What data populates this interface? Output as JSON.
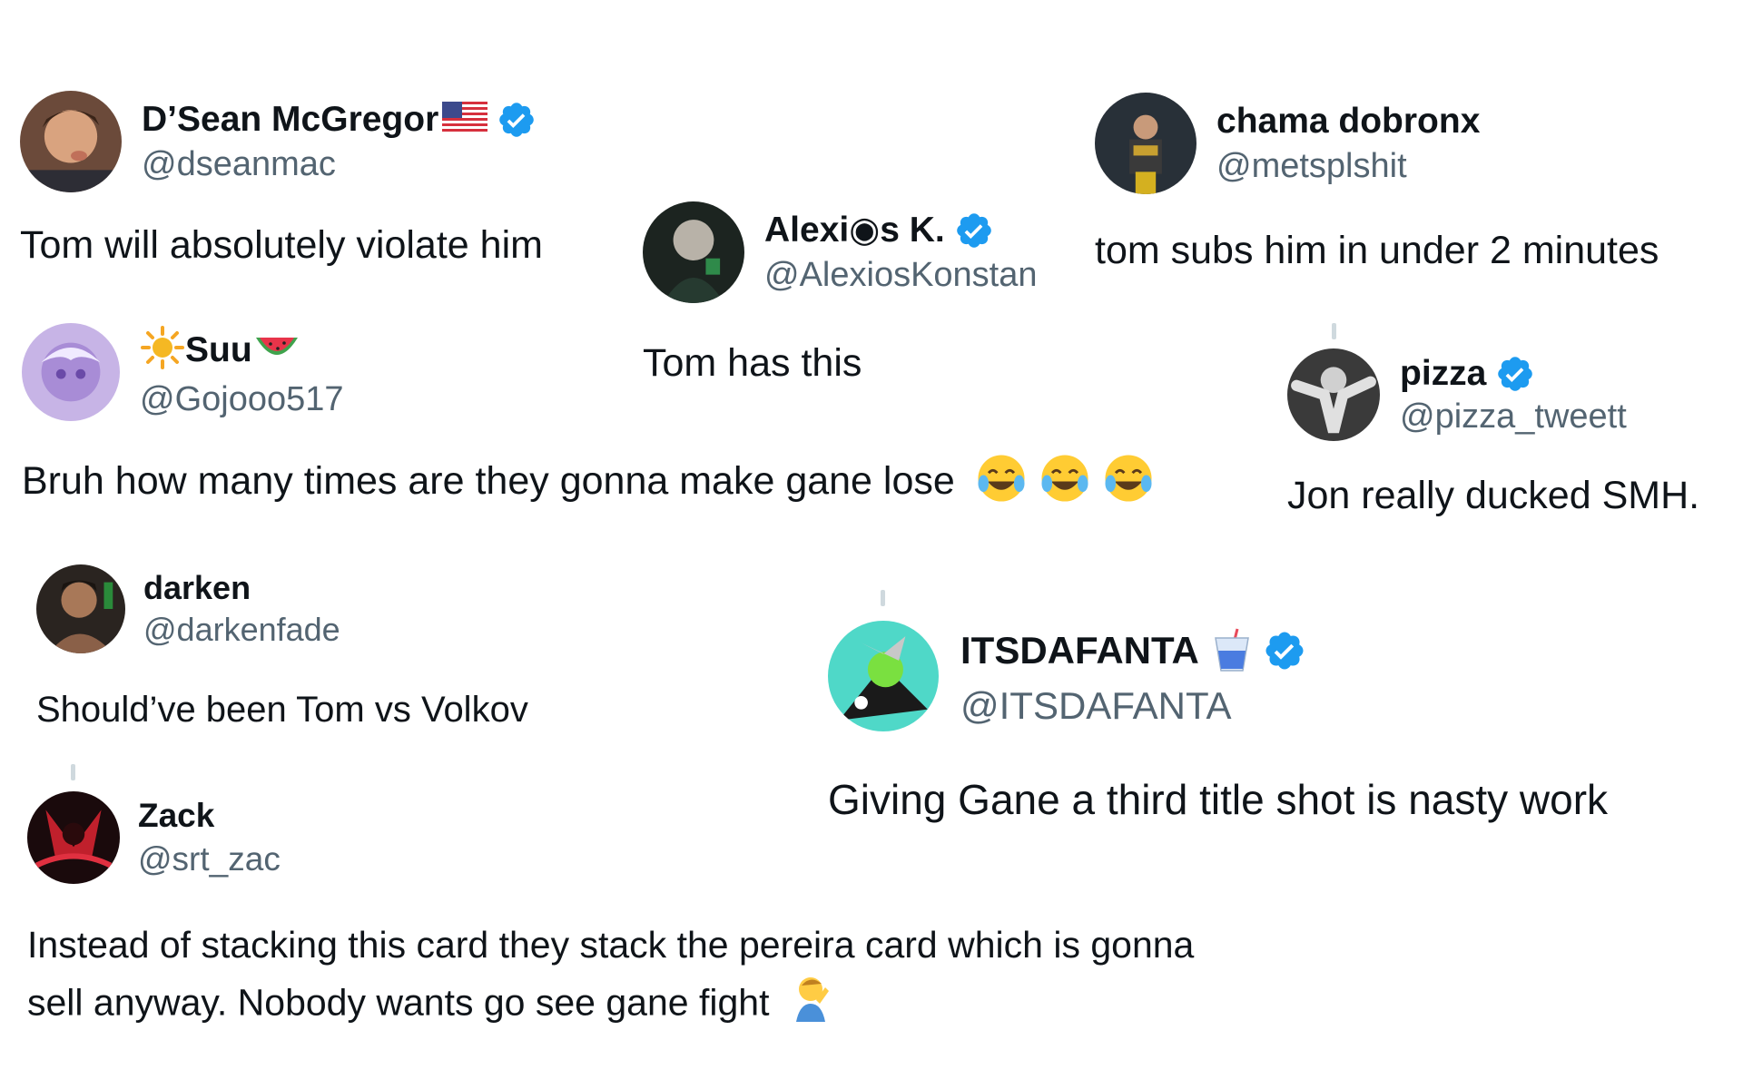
{
  "colors": {
    "text": "#0f1419",
    "handle": "#536471",
    "verified": "#1d9bf0",
    "thread_line": "#cfd9de"
  },
  "tweets": [
    {
      "id": "dseanmac",
      "name": "D’Sean McGregor",
      "name_emoji": "flag-usa-icon",
      "verified": true,
      "handle": "@dseanmac",
      "text": "Tom will absolutely violate him"
    },
    {
      "id": "alexios",
      "name": "Alexi◉s K.",
      "verified": true,
      "handle": "@AlexiosKonstan",
      "text": "Tom has this"
    },
    {
      "id": "metsplshit",
      "name": "chama dobronx",
      "verified": false,
      "handle": "@metsplshit",
      "text": "tom subs him in under 2 minutes"
    },
    {
      "id": "gojooo",
      "name": "Suu",
      "name_prefix_emoji": "sun-icon",
      "name_suffix_emoji": "watermelon-icon",
      "verified": false,
      "handle": "@Gojooo517",
      "text": "Bruh how many times are they gonna make gane lose",
      "trailing_emoji": [
        "laughing-crying-icon",
        "laughing-crying-icon",
        "laughing-crying-icon"
      ]
    },
    {
      "id": "pizza",
      "name": "pizza",
      "verified": true,
      "handle": "@pizza_tweett",
      "text": "Jon really ducked SMH."
    },
    {
      "id": "darken",
      "name": "darken",
      "verified": false,
      "handle": "@darkenfade",
      "text": "Should’ve been Tom vs Volkov"
    },
    {
      "id": "itsdafanta",
      "name": "ITSDAFANTA",
      "name_emoji": "drink-cup-icon",
      "verified": true,
      "handle": "@ITSDAFANTA",
      "text": "Giving Gane a third title shot is nasty work"
    },
    {
      "id": "zack",
      "name": "Zack",
      "verified": false,
      "handle": "@srt_zac",
      "text_line1": "Instead of stacking this card they stack the pereira card which is gonna",
      "text_line2": "sell anyway. Nobody wants go see gane fight",
      "trailing_emoji": [
        "facepalm-icon"
      ]
    }
  ]
}
